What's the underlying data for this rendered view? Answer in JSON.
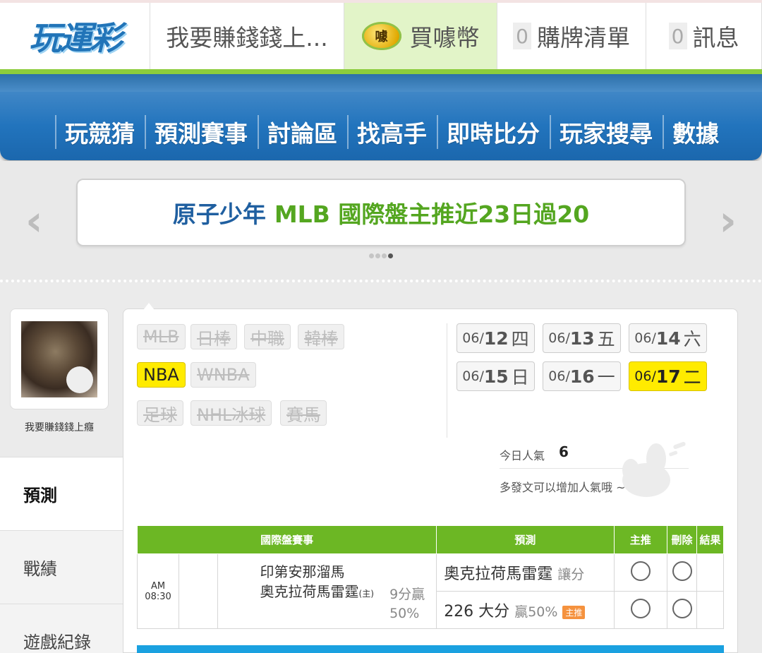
{
  "header": {
    "logo_text": "玩運彩",
    "username_truncated": "我要賺錢錢上...",
    "coin_icon_text": "噱",
    "buy_label": "買噱幣",
    "cart_count": "0",
    "cart_label": "購牌清單",
    "msg_count": "0",
    "msg_label": "訊息"
  },
  "nav": {
    "items": [
      "玩競猜",
      "預測賽事",
      "討論區",
      "找高手",
      "即時比分",
      "玩家搜尋",
      "數據"
    ]
  },
  "banner": {
    "prefix": "原子少年",
    "text": "MLB 國際盤主推近23日過20",
    "prev_arrow": "‹",
    "next_arrow": "›"
  },
  "sidebar": {
    "username": "我要賺錢錢上癮",
    "tabs": [
      "預測",
      "戰績",
      "遊戲紀錄"
    ]
  },
  "leagues": [
    {
      "label": "MLB"
    },
    {
      "label": "日棒"
    },
    {
      "label": "中職"
    },
    {
      "label": "韓棒"
    },
    {
      "label": "NBA"
    },
    {
      "label": "WNBA"
    },
    {
      "label": "足球"
    },
    {
      "label": "NHL冰球"
    },
    {
      "label": "賽馬"
    }
  ],
  "dates": [
    {
      "md": "06/",
      "dd": "12",
      "wd": "四"
    },
    {
      "md": "06/",
      "dd": "13",
      "wd": "五"
    },
    {
      "md": "06/",
      "dd": "14",
      "wd": "六"
    },
    {
      "md": "06/",
      "dd": "15",
      "wd": "日"
    },
    {
      "md": "06/",
      "dd": "16",
      "wd": "一"
    },
    {
      "md": "06/",
      "dd": "17",
      "wd": "二"
    }
  ],
  "popularity": {
    "label": "今日人氣",
    "value": "6",
    "tip": "多發文可以增加人氣哦 ~"
  },
  "table": {
    "headers": [
      "國際盤賽事",
      "預測",
      "主推",
      "刪除",
      "結果"
    ],
    "row": {
      "time": "AM 08:30",
      "away_team": "印第安那溜馬",
      "home_team": "奧克拉荷馬雷霆",
      "home_mark": "(主)",
      "result_line1": "9分贏",
      "result_line2": "50%",
      "pred1_team": "奧克拉荷馬雷霆",
      "pred1_type": "讓分",
      "pred2_value": "226 大分",
      "pred2_extra": "贏50%",
      "pred2_badge": "主推"
    }
  },
  "colors": {
    "accent_green": "#6cb724",
    "nav_blue": "#2274bd",
    "highlight_yellow": "#ffeb00"
  }
}
